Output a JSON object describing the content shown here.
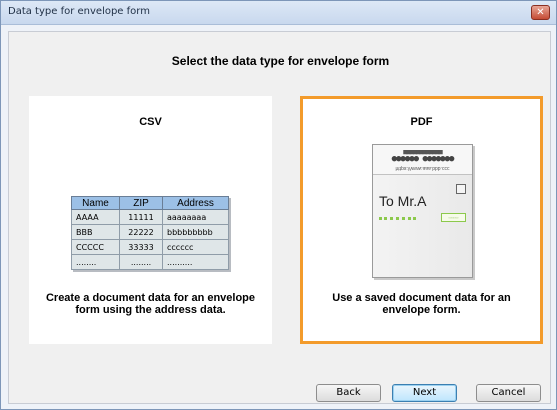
{
  "window": {
    "title": "Data type for envelope form",
    "close_label": "✕"
  },
  "prompt": "Select the data type for envelope form",
  "options": {
    "csv": {
      "title": "CSV",
      "description": "Create a document data for an envelope form using the address data.",
      "table": {
        "headers": [
          "Name",
          "ZIP",
          "Address"
        ],
        "rows": [
          [
            "AAAA",
            "11111",
            "aaaaaaaa"
          ],
          [
            "BBB",
            "22222",
            "bbbbbbbbb"
          ],
          [
            "CCCCC",
            "33333",
            "cccccc"
          ],
          [
            "........",
            "........",
            ".........."
          ]
        ]
      }
    },
    "pdf": {
      "title": "PDF",
      "description": "Use a saved document data for an envelope form.",
      "selected": true,
      "accent_color": "#f39b2b",
      "envelope": {
        "dots_line1": "■■■■■■■■■■■■",
        "dots_line2": "●●●●●● ●●●●●●●",
        "url": "https://www.aaa.bbb.ccc",
        "recipient": "To Mr.A",
        "zip_box": "▫▫▫▫▫▫▫"
      }
    }
  },
  "buttons": {
    "back": "Back",
    "next": "Next",
    "cancel": "Cancel"
  }
}
